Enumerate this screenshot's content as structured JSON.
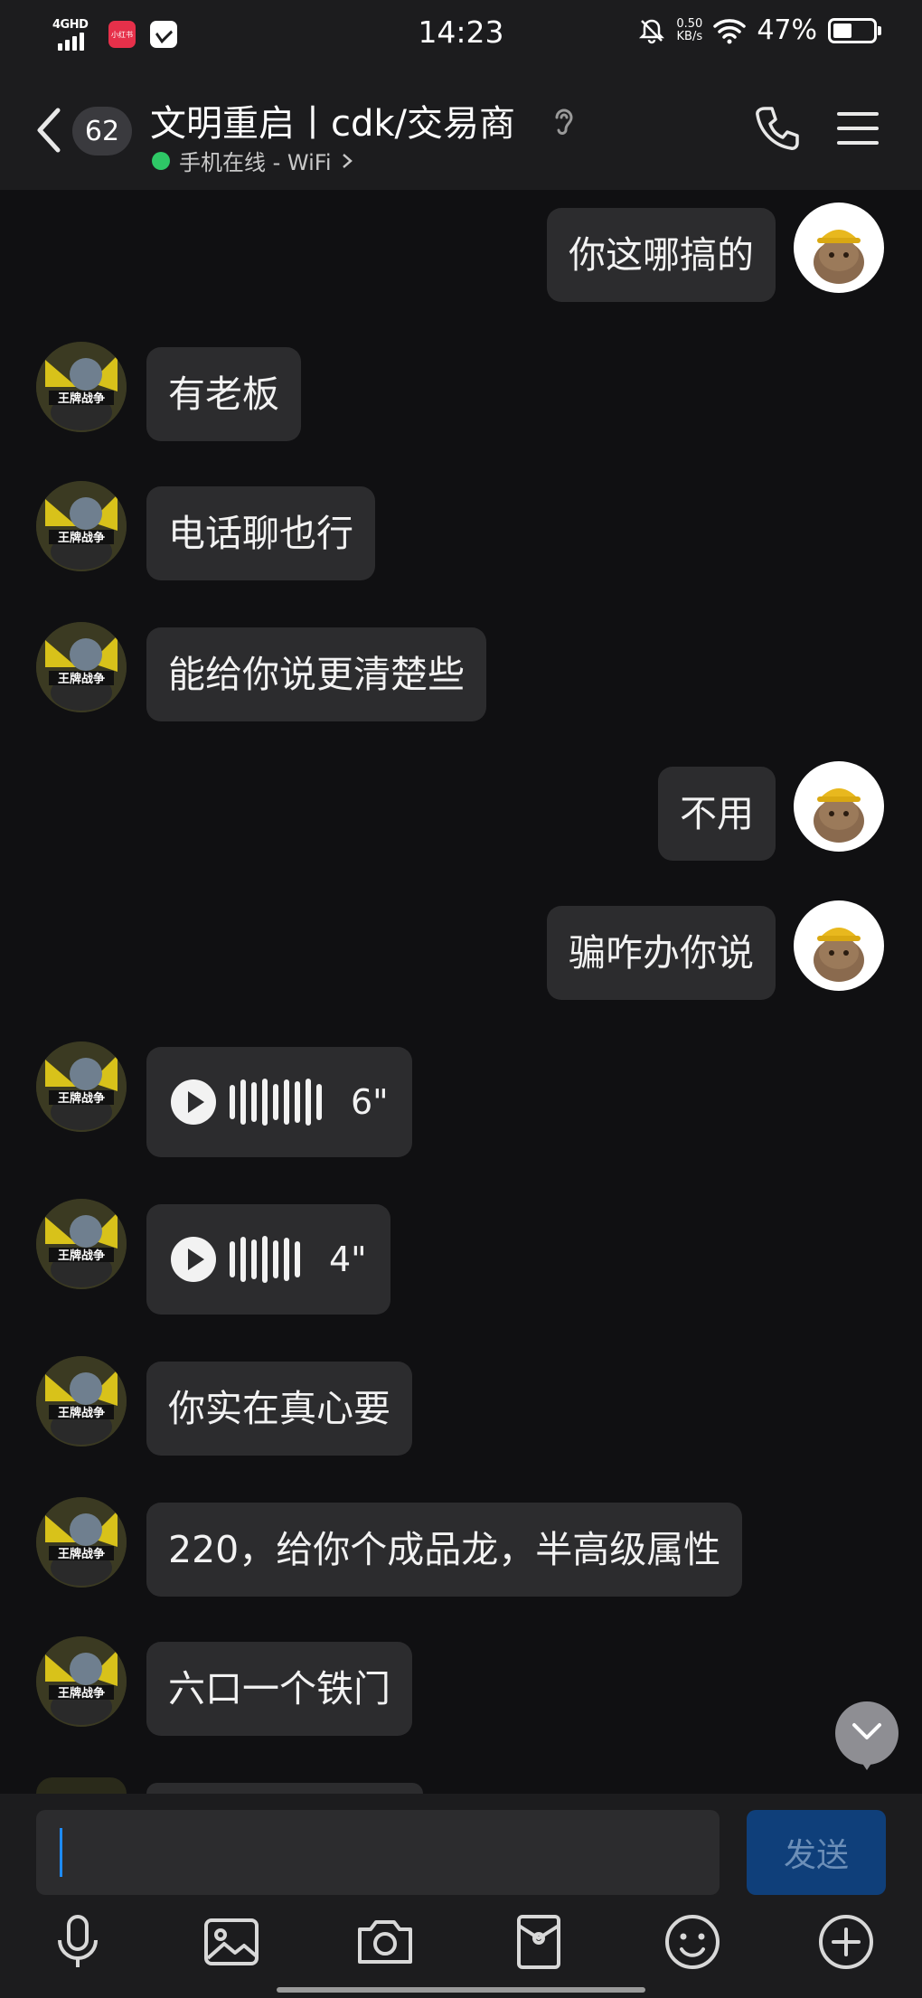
{
  "status_bar": {
    "network": "4GHD",
    "app_badge": "小红书",
    "time": "14:23",
    "speed_value": "0.50",
    "speed_unit": "KB/s",
    "battery_pct": "47%",
    "battery_level": 0.47,
    "icons": [
      "signal-icon",
      "app-notification-icon",
      "message-notification-icon",
      "mute-icon",
      "wifi-icon",
      "battery-icon"
    ]
  },
  "header": {
    "unread_count": "62",
    "title": "文明重启丨cdk/交易商",
    "presence": "手机在线 - WiFi",
    "presence_color": "#2ec866",
    "icons": [
      "back-icon",
      "ear-icon",
      "phone-icon",
      "menu-icon"
    ]
  },
  "messages": [
    {
      "side": "right",
      "text": "你这哪搞的"
    },
    {
      "side": "left",
      "text": "有老板"
    },
    {
      "side": "left",
      "text": "电话聊也行"
    },
    {
      "side": "left",
      "text": "能给你说更清楚些"
    },
    {
      "side": "right",
      "text": "不用"
    },
    {
      "side": "right",
      "text": "骗咋办你说"
    },
    {
      "side": "left",
      "type": "voice",
      "duration": "6\""
    },
    {
      "side": "left",
      "type": "voice",
      "duration": "4\""
    },
    {
      "side": "left",
      "text": "你实在真心要"
    },
    {
      "side": "left",
      "text": "220，给你个成品龙，半高级属性"
    },
    {
      "side": "left",
      "text": "六口一个铁门"
    }
  ],
  "composer": {
    "input_value": "",
    "send_label": "发送",
    "tools": [
      "microphone-icon",
      "image-icon",
      "camera-icon",
      "red-packet-icon",
      "emoji-icon",
      "plus-icon"
    ]
  },
  "colors": {
    "background": "#101012",
    "bar": "#1c1c1e",
    "bubble": "#2c2c2e",
    "send_button": "#0f3f7a",
    "caret": "#1e8cff"
  }
}
